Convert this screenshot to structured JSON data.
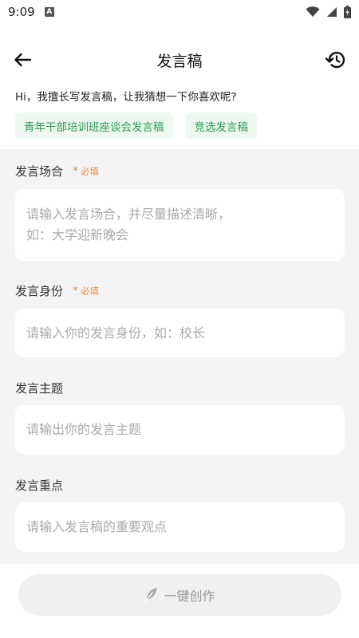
{
  "status": {
    "time": "9:09",
    "notif_letter": "A"
  },
  "nav": {
    "title": "发言稿"
  },
  "greeting": "Hi，我擅长写发言稿，让我猜想一下你喜欢呢?",
  "chips": [
    "青年干部培训班座谈会发言稿",
    "竞选发言稿"
  ],
  "fields": [
    {
      "label": "发言场合",
      "required_text": "必填",
      "placeholder": "请输入发言场合，并尽量描述清晰，\n如：大学迎新晚会"
    },
    {
      "label": "发言身份",
      "required_text": "必填",
      "placeholder": "请输入你的发言身份，如：校长"
    },
    {
      "label": "发言主题",
      "required_text": "",
      "placeholder": "请输出你的发言主题"
    },
    {
      "label": "发言重点",
      "required_text": "",
      "placeholder": "请输入发言稿的重要观点"
    }
  ],
  "create_button": {
    "label": "一键创作"
  },
  "colors": {
    "accent_green": "#2e9a54",
    "chip_bg": "#eef8f0",
    "required_orange": "#f28c3a",
    "form_bg": "#f4f4f7"
  },
  "icons": {
    "back": "arrow-left-icon",
    "history": "history-icon",
    "create": "feather-icon"
  }
}
